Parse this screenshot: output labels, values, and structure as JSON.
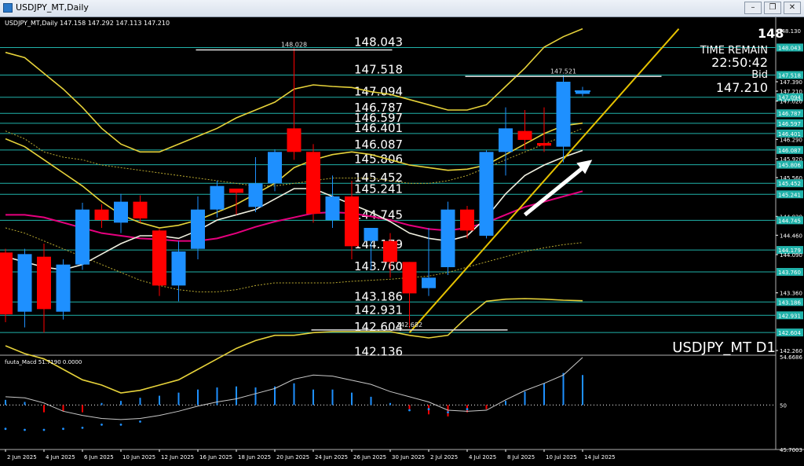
{
  "window": {
    "title": "USDJPY_MT,Daily",
    "controls": [
      "minimize-icon",
      "restore-icon",
      "close-icon"
    ]
  },
  "header": {
    "ohlc_text": "USDJPY_MT,Daily  147.158 147.292 147.113 147.210"
  },
  "info": {
    "top_partial": "148",
    "time_remain_label": "TIME REMAIN",
    "time_remain_value": "22:50:42",
    "bid_label": "Bid",
    "bid_value": "147.210",
    "watermark": "USDJPY_MT D1"
  },
  "colors": {
    "bull": "#1e90ff",
    "bear": "#ff0000",
    "hline": "#20b2aa",
    "bollinger": "#e6d23a",
    "ma_fast": "#f0f0e0",
    "ma_pink": "#e6007e",
    "trendline": "#e6c200",
    "arrow": "#ffffff"
  },
  "chart_data": [
    {
      "type": "candlestick",
      "title": "USDJPY_MT,Daily",
      "ylim": [
        142.26,
        148.32
      ],
      "x_tick_labels": [
        "2 Jun 2025",
        "4 Jun 2025",
        "6 Jun 2025",
        "10 Jun 2025",
        "12 Jun 2025",
        "16 Jun 2025",
        "18 Jun 2025",
        "20 Jun 2025",
        "24 Jun 2025",
        "26 Jun 2025",
        "30 Jun 2025",
        "2 Jul 2025",
        "4 Jul 2025",
        "8 Jul 2025",
        "10 Jul 2025",
        "14 Jul 2025"
      ],
      "y_axis_ticks": [
        "148.043",
        "147.518",
        "147.390",
        "147.210",
        "147.094",
        "147.020",
        "146.787",
        "146.597",
        "146.401",
        "146.290",
        "146.087",
        "145.920",
        "145.806",
        "145.560",
        "145.452",
        "145.241",
        "144.820",
        "144.745",
        "144.460",
        "144.179",
        "144.090",
        "143.760",
        "143.360",
        "143.186",
        "142.931",
        "142.604",
        "142.260"
      ],
      "axis_top_partial": "148.130",
      "horizontal_levels": [
        148.043,
        147.518,
        147.094,
        146.787,
        146.597,
        146.401,
        146.087,
        145.806,
        145.452,
        145.241,
        144.745,
        144.179,
        143.76,
        143.186,
        142.931,
        142.604,
        142.136
      ],
      "level_labels": [
        "148.043",
        "147.518",
        "147.094",
        "146.787",
        "146.597",
        "146.401",
        "146.087",
        "145.806",
        "145.452",
        "145.241",
        "144.745",
        "144.179",
        "143.760",
        "143.186",
        "142.931",
        "142.604",
        "142.136"
      ],
      "annotations": [
        {
          "text": "148.028",
          "price": 148.028,
          "candle": 15
        },
        {
          "text": "147.521",
          "price": 147.521,
          "candle": 29
        },
        {
          "text": "142.682",
          "price": 142.682,
          "candle": 21
        }
      ],
      "candles": [
        [
          144.13,
          144.2,
          142.8,
          142.95
        ],
        [
          143.0,
          144.2,
          142.7,
          144.1
        ],
        [
          144.05,
          144.3,
          142.6,
          143.05
        ],
        [
          143.0,
          144.0,
          142.85,
          143.9
        ],
        [
          143.9,
          145.08,
          143.8,
          144.95
        ],
        [
          144.95,
          145.05,
          144.6,
          144.75
        ],
        [
          144.7,
          145.25,
          144.5,
          145.1
        ],
        [
          145.1,
          145.22,
          144.7,
          144.78
        ],
        [
          144.55,
          144.58,
          143.3,
          143.5
        ],
        [
          143.5,
          144.35,
          143.2,
          144.15
        ],
        [
          144.2,
          145.2,
          144.0,
          144.95
        ],
        [
          144.95,
          145.5,
          144.8,
          145.4
        ],
        [
          145.35,
          145.35,
          144.85,
          145.27
        ],
        [
          145.0,
          145.95,
          144.9,
          145.45
        ],
        [
          145.45,
          146.1,
          145.3,
          146.05
        ],
        [
          146.5,
          148.03,
          145.9,
          146.05
        ],
        [
          146.05,
          146.2,
          144.7,
          144.87
        ],
        [
          144.75,
          145.6,
          144.6,
          145.2
        ],
        [
          145.2,
          145.5,
          144.0,
          144.25
        ],
        [
          144.35,
          144.6,
          143.8,
          144.6
        ],
        [
          144.35,
          144.5,
          143.65,
          143.95
        ],
        [
          143.95,
          143.95,
          142.682,
          143.35
        ],
        [
          143.45,
          144.6,
          143.3,
          143.65
        ],
        [
          143.85,
          145.1,
          143.7,
          144.95
        ],
        [
          144.95,
          145.02,
          144.4,
          144.55
        ],
        [
          144.45,
          146.08,
          144.4,
          146.05
        ],
        [
          146.05,
          146.9,
          145.6,
          146.5
        ],
        [
          146.45,
          146.85,
          146.1,
          146.28
        ],
        [
          146.22,
          146.9,
          146.05,
          146.17
        ],
        [
          146.15,
          147.521,
          145.85,
          147.39
        ],
        [
          147.158,
          147.292,
          147.113,
          147.21
        ]
      ],
      "indicator_lines": {
        "bb_upper": [
          147.95,
          147.85,
          147.55,
          147.25,
          146.9,
          146.5,
          146.2,
          146.05,
          146.05,
          146.2,
          146.35,
          146.5,
          146.7,
          146.85,
          147.0,
          147.25,
          147.33,
          147.3,
          147.28,
          147.2,
          147.15,
          147.05,
          146.95,
          146.85,
          146.85,
          146.95,
          147.3,
          147.65,
          148.05,
          148.25,
          148.4
        ],
        "bb_mid": [
          146.3,
          146.15,
          145.9,
          145.65,
          145.4,
          145.1,
          144.85,
          144.7,
          144.6,
          144.65,
          144.75,
          144.9,
          145.05,
          145.25,
          145.45,
          145.75,
          145.9,
          146.0,
          146.05,
          146.0,
          145.9,
          145.8,
          145.75,
          145.7,
          145.72,
          145.8,
          146.0,
          146.2,
          146.4,
          146.55,
          146.6
        ],
        "bb_lower": [
          142.35,
          142.2,
          142.1,
          141.9,
          141.7,
          141.6,
          141.45,
          141.5,
          141.6,
          141.7,
          141.9,
          142.1,
          142.3,
          142.45,
          142.55,
          142.55,
          142.6,
          142.62,
          142.62,
          142.62,
          142.62,
          142.55,
          142.5,
          142.55,
          142.9,
          143.2,
          143.24,
          143.25,
          143.24,
          143.22,
          143.21
        ],
        "ma_fast": [
          144.05,
          143.95,
          143.85,
          143.8,
          143.9,
          144.1,
          144.3,
          144.45,
          144.45,
          144.4,
          144.55,
          144.75,
          144.85,
          144.95,
          145.15,
          145.35,
          145.35,
          145.2,
          145.05,
          144.9,
          144.72,
          144.5,
          144.4,
          144.35,
          144.45,
          144.8,
          145.25,
          145.6,
          145.8,
          145.95,
          146.08
        ],
        "ma_pink": [
          144.85,
          144.85,
          144.8,
          144.7,
          144.6,
          144.5,
          144.45,
          144.4,
          144.38,
          144.35,
          144.35,
          144.4,
          144.5,
          144.62,
          144.72,
          144.8,
          144.88,
          144.9,
          144.88,
          144.82,
          144.75,
          144.65,
          144.58,
          144.55,
          144.6,
          144.7,
          144.85,
          145.0,
          145.1,
          145.2,
          145.3
        ],
        "dotted_upper": [
          146.45,
          146.3,
          146.05,
          145.95,
          145.9,
          145.8,
          145.75,
          145.7,
          145.65,
          145.6,
          145.55,
          145.5,
          145.45,
          145.4,
          145.4,
          145.45,
          145.5,
          145.55,
          145.55,
          145.55,
          145.5,
          145.45,
          145.45,
          145.5,
          145.6,
          145.75,
          145.9,
          146.05,
          146.2,
          146.35,
          146.5
        ],
        "dotted_lower": [
          144.6,
          144.5,
          144.35,
          144.2,
          144.05,
          143.9,
          143.75,
          143.6,
          143.5,
          143.42,
          143.38,
          143.38,
          143.42,
          143.5,
          143.55,
          143.55,
          143.55,
          143.55,
          143.58,
          143.6,
          143.62,
          143.65,
          143.68,
          143.75,
          143.85,
          143.95,
          144.05,
          144.15,
          144.22,
          144.28,
          144.32
        ]
      },
      "trendline": {
        "from": {
          "candle": 21,
          "price": 142.6
        },
        "to": {
          "candle": 35,
          "price": 148.4
        }
      },
      "arrow": {
        "from": {
          "candle": 27,
          "price": 144.85
        },
        "to": {
          "candle": 30.5,
          "price": 145.9
        }
      },
      "xlabel": "",
      "ylabel": ""
    },
    {
      "type": "bar",
      "title": "fuuta_Macd 51.7190  0.0000",
      "ylim": [
        45.7003,
        54.6686
      ],
      "y_axis_ticks": [
        "54.6686",
        "50",
        "45.7003"
      ],
      "zero_level": 50,
      "histogram": [
        50.5,
        50.3,
        49.3,
        49.4,
        49.3,
        50.2,
        50.4,
        50.7,
        50.9,
        51.2,
        51.5,
        51.7,
        51.8,
        51.7,
        51.8,
        52.1,
        51.5,
        51.5,
        51.2,
        50.8,
        50.2,
        49.6,
        49.1,
        48.9,
        49.3,
        49.6,
        50.4,
        51.3,
        52.1,
        53.1,
        52.9
      ],
      "signal": [
        50.8,
        50.7,
        50.2,
        49.4,
        49.0,
        48.7,
        48.6,
        48.7,
        49.0,
        49.4,
        49.9,
        50.3,
        50.6,
        51.1,
        51.6,
        52.5,
        52.9,
        52.8,
        52.4,
        52.0,
        51.3,
        50.8,
        50.3,
        49.5,
        49.4,
        49.5,
        50.5,
        51.4,
        52.1,
        52.9,
        54.6
      ],
      "dots": [
        47.7,
        47.6,
        47.6,
        47.7,
        47.8,
        48.1,
        48.1,
        48.4,
        null,
        null,
        null,
        null,
        null,
        null,
        null,
        null,
        null,
        null,
        null,
        null,
        null,
        49.5,
        49.6,
        49.3,
        49.6,
        null,
        null,
        null,
        null,
        null,
        null
      ]
    }
  ]
}
